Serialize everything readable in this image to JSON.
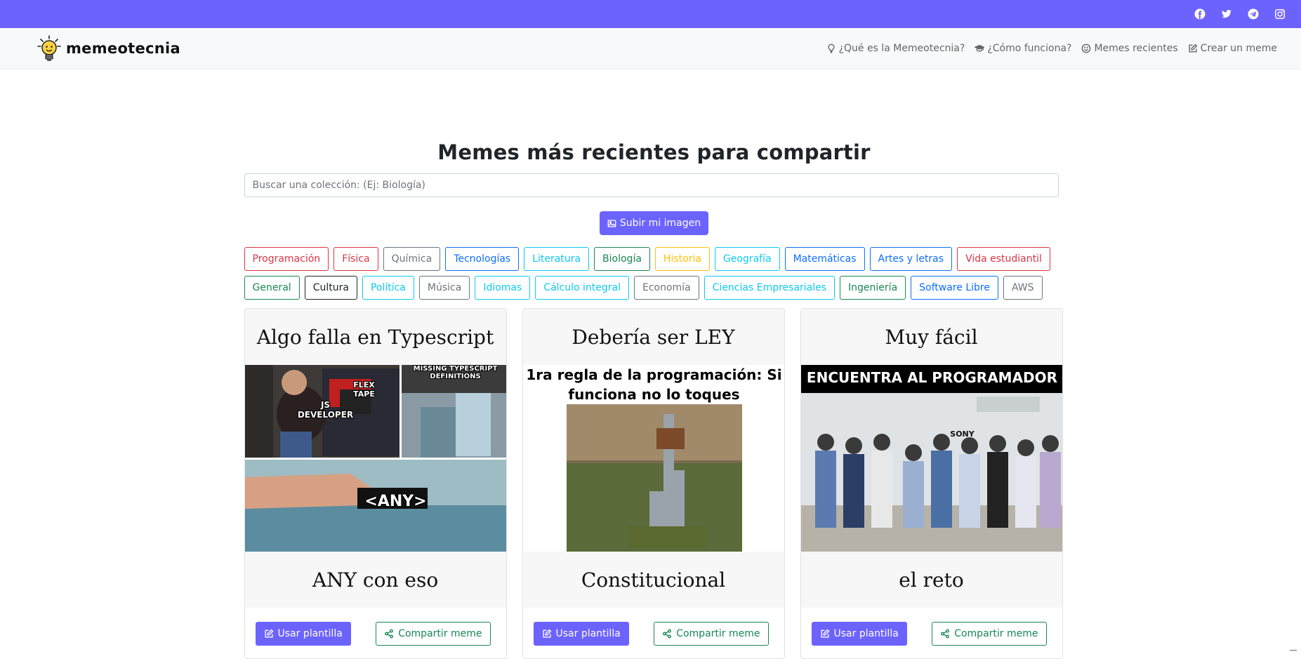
{
  "topbar": {
    "social": [
      {
        "name": "facebook-icon"
      },
      {
        "name": "twitter-icon"
      },
      {
        "name": "telegram-icon"
      },
      {
        "name": "instagram-icon"
      }
    ]
  },
  "navbar": {
    "brand": "memeotecnia",
    "links": [
      {
        "label": "¿Qué es la Memeotecnia?",
        "icon": "lightbulb-icon"
      },
      {
        "label": "¿Cómo funciona?",
        "icon": "graduation-cap-icon"
      },
      {
        "label": "Memes recientes",
        "icon": "smile-icon"
      },
      {
        "label": "Crear un meme",
        "icon": "pencil-square-icon"
      }
    ]
  },
  "main": {
    "title": "Memes más recientes para compartir",
    "search_placeholder": "Buscar una colección: (Ej: Biología)",
    "upload_label": "Subir mi imagen"
  },
  "tags": [
    {
      "label": "Programación",
      "color": "#dc3545"
    },
    {
      "label": "Física",
      "color": "#dc3545"
    },
    {
      "label": "Química",
      "color": "#6c757d"
    },
    {
      "label": "Tecnologías",
      "color": "#0d6efd"
    },
    {
      "label": "Literatura",
      "color": "#0dcaf0"
    },
    {
      "label": "Biología",
      "color": "#198754"
    },
    {
      "label": "Historia",
      "color": "#ffc107"
    },
    {
      "label": "Geografía",
      "color": "#0dcaf0"
    },
    {
      "label": "Matemáticas",
      "color": "#0d6efd"
    },
    {
      "label": "Artes y letras",
      "color": "#0d6efd"
    },
    {
      "label": "Vida estudiantil",
      "color": "#dc3545"
    },
    {
      "label": "General",
      "color": "#198754"
    },
    {
      "label": "Cultura",
      "color": "#212529"
    },
    {
      "label": "Política",
      "color": "#0dcaf0"
    },
    {
      "label": "Música",
      "color": "#6c757d"
    },
    {
      "label": "Idiomas",
      "color": "#0dcaf0"
    },
    {
      "label": "Cálculo integral",
      "color": "#0dcaf0"
    },
    {
      "label": "Economía",
      "color": "#6c757d"
    },
    {
      "label": "Ciencias Empresariales",
      "color": "#0dcaf0"
    },
    {
      "label": "Ingeniería",
      "color": "#198754"
    },
    {
      "label": "Software Libre",
      "color": "#0d6efd"
    },
    {
      "label": "AWS",
      "color": "#6c757d"
    }
  ],
  "cards": [
    {
      "top": "Algo falla en Typescript",
      "bottom": "ANY con eso",
      "captions": [
        "MISSING TYPESCRIPT DEFINITIONS",
        "JS DEVELOPER",
        "FLEX TAPE",
        "<ANY>"
      ]
    },
    {
      "top": "Debería ser LEY",
      "bottom": "Constitucional",
      "captions": [
        "1ra regla de la programación: Si funciona no lo toques"
      ]
    },
    {
      "top": "Muy fácil",
      "bottom": "el reto",
      "captions": [
        "ENCUENTRA AL PROGRAMADOR",
        "SONY"
      ]
    }
  ],
  "card_buttons": {
    "use": "Usar plantilla",
    "share": "Compartir meme"
  }
}
